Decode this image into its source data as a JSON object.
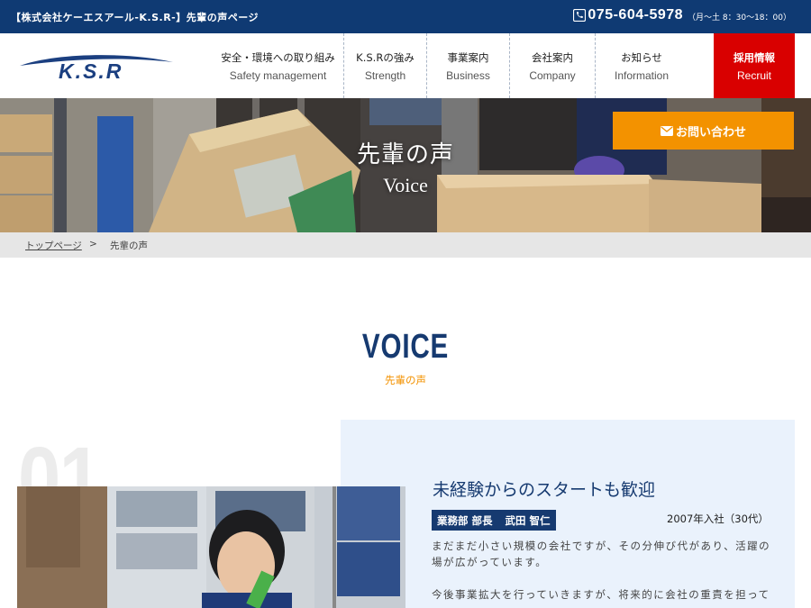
{
  "topbar": {
    "site_name": "【株式会社ケーエスアール-K.S.R-】先輩の声ページ",
    "phone": "075-604-5978",
    "hours": "（月～土 8：30～18：00）"
  },
  "header": {
    "logo_text": "K.S.R",
    "nav": [
      {
        "jp": "安全・環境への取り組み",
        "en": "Safety management"
      },
      {
        "jp": "K.S.Rの強み",
        "en": "Strength"
      },
      {
        "jp": "事業案内",
        "en": "Business"
      },
      {
        "jp": "会社案内",
        "en": "Company"
      },
      {
        "jp": "お知らせ",
        "en": "Information"
      }
    ],
    "recruit": {
      "jp": "採用情報",
      "en": "Recruit"
    }
  },
  "hero": {
    "title_jp": "先輩の声",
    "title_en": "Voice",
    "contact_label": "お問い合わせ"
  },
  "breadcrumb": {
    "home": "トップページ",
    "separator": ">",
    "current": "先輩の声"
  },
  "section": {
    "title": "VOICE",
    "subtitle": "先輩の声"
  },
  "voice": {
    "number": "01",
    "title": "未経験からのスタートも歓迎",
    "position": "業務部 部長",
    "name": "武田 智仁",
    "joined": "2007年入社（30代）",
    "body1": "まだまだ小さい規模の会社ですが、その分伸び代があり、活躍の場が広がっています。",
    "body2": "今後事業拡大を行っていきますが、将来的に会社の重責を担って"
  },
  "colors": {
    "navy": "#0f3a73",
    "accent_orange": "#f39200",
    "recruit_red": "#d90000",
    "card_bg": "#eaf2fc"
  }
}
